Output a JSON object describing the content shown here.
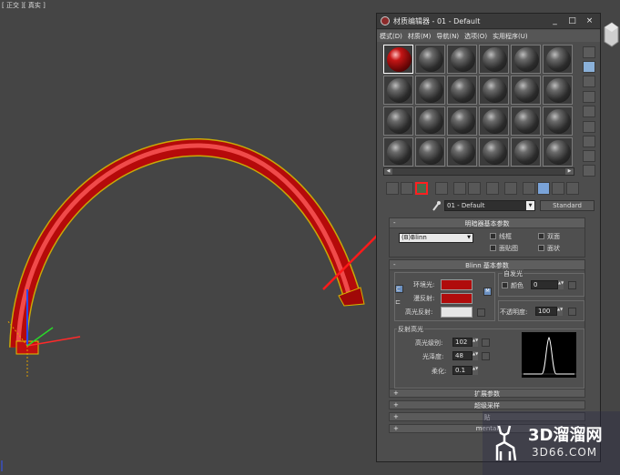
{
  "viewport": {
    "label": "[ 正交 ][ 真实 ]"
  },
  "material_editor": {
    "title": "材质编辑器 - 01 - Default",
    "menu": [
      "模式(D)",
      "材质(M)",
      "导航(N)",
      "选项(O)",
      "实用程序(U)"
    ],
    "window_buttons": [
      "_",
      "□",
      "×"
    ],
    "sample_slots": {
      "rows": 4,
      "cols": 6,
      "active_index": 0,
      "active_color": "#c41515"
    },
    "material_name": "01 - Default",
    "material_type": "Standard"
  },
  "shader_basic": {
    "title": "明暗器基本参数",
    "sign": "-",
    "shader": "(B)Blinn",
    "options": [
      "线框",
      "双面",
      "面贴图",
      "面状"
    ]
  },
  "blinn_basic": {
    "title": "Blinn 基本参数",
    "sign": "-",
    "ambient_label": "环境光:",
    "diffuse_label": "漫反射:",
    "specular_label": "高光反射:",
    "ambient_color": "#b00c0c",
    "diffuse_color": "#b00c0c",
    "specular_color": "#e6e6e6",
    "self_illum_group": "自发光",
    "color_label": "颜色",
    "self_illum_value": "0",
    "opacity_label": "不透明度:",
    "opacity_value": "100",
    "lock_icon": "C",
    "map_button": "M"
  },
  "specular_highlights": {
    "group": "反射高光",
    "level_label": "高光级别:",
    "level_value": "102",
    "gloss_label": "光泽度:",
    "gloss_value": "48",
    "soften_label": "柔化:",
    "soften_value": "0.1"
  },
  "collapsed_rollouts": [
    {
      "sign": "+",
      "title": "扩展参数"
    },
    {
      "sign": "+",
      "title": "超级采样"
    },
    {
      "sign": "+",
      "title": "贴"
    },
    {
      "sign": "+",
      "title": "mental"
    }
  ],
  "watermark": {
    "brand": "3D溜溜网",
    "url": "3D66.COM"
  },
  "colors": {
    "viewport_bg": "#454545",
    "tube": "#cc1111",
    "highlight_box": "#ff2020",
    "arrow": "#ff1a1a"
  }
}
